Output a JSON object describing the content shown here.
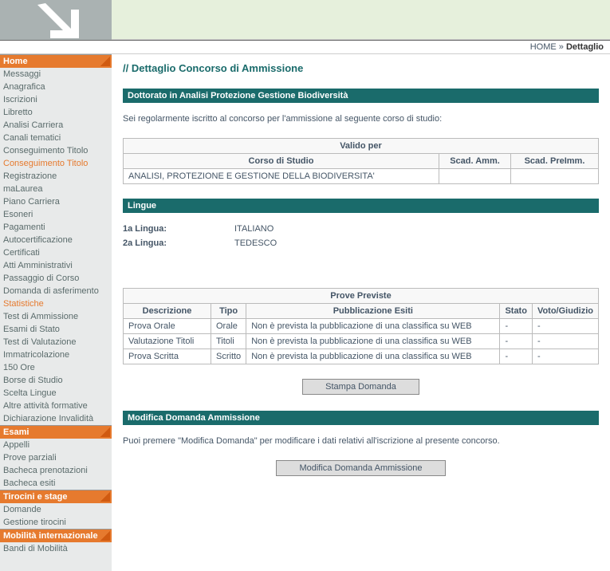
{
  "breadcrumb": {
    "home": "HOME",
    "sep": " » ",
    "current": "Dettaglio"
  },
  "page_title_prefix": "// ",
  "page_title": "Dettaglio Concorso di Ammissione",
  "sidebar": {
    "sections": [
      {
        "title": "Home",
        "items": [
          {
            "label": "Messaggi"
          },
          {
            "label": "Anagrafica"
          },
          {
            "label": "Iscrizioni"
          },
          {
            "label": "Libretto"
          },
          {
            "label": "Analisi Carriera"
          },
          {
            "label": "Canali tematici"
          },
          {
            "label": "Conseguimento Titolo"
          },
          {
            "label": "Conseguimento Titolo",
            "active": true
          },
          {
            "label": "Registrazione"
          },
          {
            "label": "maLaurea"
          },
          {
            "label": "Piano Carriera"
          },
          {
            "label": "Esoneri"
          },
          {
            "label": "Pagamenti"
          },
          {
            "label": "Autocertificazione"
          },
          {
            "label": "Certificati"
          },
          {
            "label": "Atti Amministrativi"
          },
          {
            "label": "Passaggio di Corso"
          },
          {
            "label": "Domanda di asferimento"
          },
          {
            "label": "Statistiche",
            "active": true
          },
          {
            "label": "Test di Ammissione"
          },
          {
            "label": "Esami di Stato"
          },
          {
            "label": "Test di Valutazione"
          },
          {
            "label": "Immatricolazione"
          },
          {
            "label": "150 Ore"
          },
          {
            "label": "Borse di Studio"
          },
          {
            "label": "Scelta Lingue"
          },
          {
            "label": "Altre attività formative"
          },
          {
            "label": "Dichiarazione Invalidità"
          }
        ]
      },
      {
        "title": "Esami",
        "items": [
          {
            "label": "Appelli"
          },
          {
            "label": "Prove parziali"
          },
          {
            "label": "Bacheca prenotazioni"
          },
          {
            "label": "Bacheca esiti"
          }
        ]
      },
      {
        "title": "Tirocini e stage",
        "items": [
          {
            "label": "Domande"
          },
          {
            "label": "Gestione tirocini"
          }
        ]
      },
      {
        "title": "Mobilità internazionale",
        "items": [
          {
            "label": "Bandi di Mobilità"
          }
        ]
      }
    ]
  },
  "dottorato": {
    "title": "Dottorato in Analisi Protezione Gestione Biodiversità"
  },
  "intro_text": "Sei regolarmente iscritto al concorso per l'ammissione al seguente corso di studio:",
  "valido": {
    "header": "Valido per",
    "col_corso": "Corso di Studio",
    "col_scad_amm": "Scad. Amm.",
    "col_scad_preimm": "Scad. PreImm.",
    "rows": [
      {
        "corso": "ANALISI, PROTEZIONE E GESTIONE DELLA BIODIVERSITA'",
        "scad_amm": "",
        "scad_preimm": ""
      }
    ]
  },
  "lingue": {
    "title": "Lingue",
    "row1_label": "1a Lingua:",
    "row1_value": "ITALIANO",
    "row2_label": "2a Lingua:",
    "row2_value": "TEDESCO"
  },
  "prove": {
    "header": "Prove Previste",
    "col_desc": "Descrizione",
    "col_tipo": "Tipo",
    "col_pub": "Pubblicazione Esiti",
    "col_stato": "Stato",
    "col_voto": "Voto/Giudizio",
    "rows": [
      {
        "desc": "Prova Orale",
        "tipo": "Orale",
        "pub": "Non è prevista la pubblicazione di una classifica su WEB",
        "stato": "-",
        "voto": "-"
      },
      {
        "desc": "Valutazione Titoli",
        "tipo": "Titoli",
        "pub": "Non è prevista la pubblicazione di una classifica su WEB",
        "stato": "-",
        "voto": "-"
      },
      {
        "desc": "Prova Scritta",
        "tipo": "Scritto",
        "pub": "Non è prevista la pubblicazione di una classifica su WEB",
        "stato": "-",
        "voto": "-"
      }
    ]
  },
  "buttons": {
    "stampa": "Stampa Domanda",
    "modifica": "Modifica Domanda Ammissione"
  },
  "modifica": {
    "title": "Modifica Domanda Ammissione",
    "text": "Puoi premere \"Modifica Domanda\" per modificare i dati relativi all'iscrizione al presente concorso."
  }
}
